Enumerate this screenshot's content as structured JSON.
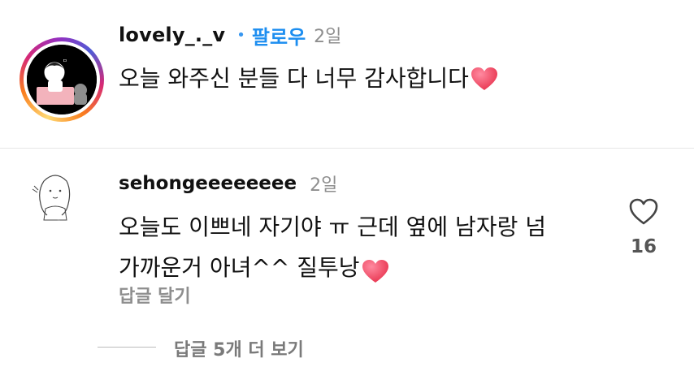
{
  "post": {
    "username": "lovely_._v",
    "separator": "•",
    "follow_label": "팔로우",
    "time": "2일",
    "text": "오늘 와주신 분들 다 너무 감사합니다",
    "emoji": "heart-emoji"
  },
  "comment": {
    "username": "sehongeeeeeeee",
    "time": "2일",
    "text_line1": "오늘도 이쁘네 자기야 ㅠ 근데 옆에 남자랑 넘",
    "text_line2": "가까운거 아녀^^ 질투낭",
    "emoji": "heart-emoji",
    "like_icon": "heart-outline-icon",
    "like_count": "16",
    "reply_label": "답글 달기"
  },
  "more_replies": {
    "label": "답글 5개 더 보기"
  },
  "colors": {
    "accent_blue": "#1d8ef0",
    "muted_gray": "#8e8e8e",
    "emoji_heart": "#f2476a"
  }
}
